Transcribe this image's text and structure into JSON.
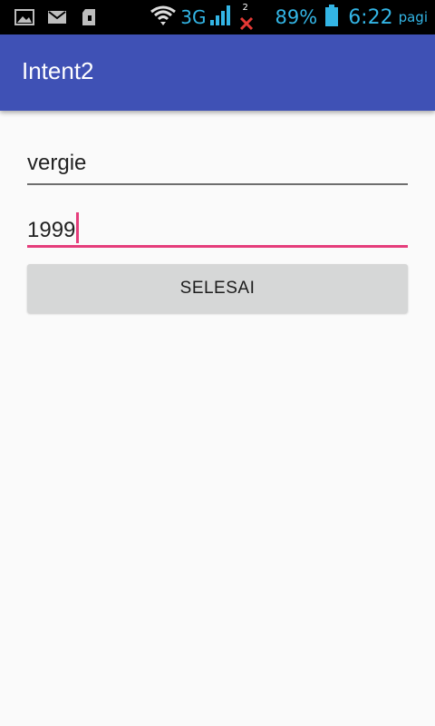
{
  "status_bar": {
    "network": "3G",
    "missed_count": "2",
    "battery": "89%",
    "time": "6:22",
    "ampm": "pagi",
    "icons": [
      "image-icon",
      "mail-icon",
      "sd-card-icon",
      "wifi-icon",
      "signal-icon",
      "missed-call-icon",
      "battery-icon"
    ],
    "accent_color": "#33b5e5"
  },
  "app_bar": {
    "title": "Intent2",
    "color": "#3f51b5"
  },
  "form": {
    "name_value": "vergie",
    "year_value": "1999",
    "focus_color": "#e53d7b",
    "submit_label": "SELESAI"
  }
}
